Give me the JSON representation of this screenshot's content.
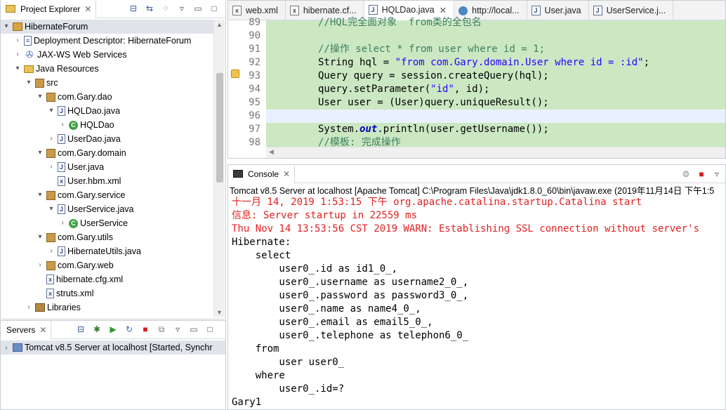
{
  "explorer": {
    "title": "Project Explorer",
    "close": "✕",
    "items": [
      {
        "label": "HibernateForum",
        "icon": "project-icon",
        "twisty": "▾"
      },
      {
        "label": "Deployment Descriptor: HibernateForum",
        "icon": "descriptor-icon",
        "twisty": "›"
      },
      {
        "label": "JAX-WS Web Services",
        "icon": "webservice-icon",
        "twisty": "›"
      },
      {
        "label": "Java Resources",
        "icon": "java-resources-icon",
        "twisty": "▾"
      },
      {
        "label": "src",
        "icon": "source-folder-icon",
        "twisty": "▾"
      },
      {
        "label": "com.Gary.dao",
        "icon": "package-icon",
        "twisty": "▾"
      },
      {
        "label": "HQLDao.java",
        "icon": "java-file-icon",
        "twisty": "▾"
      },
      {
        "label": "HQLDao",
        "icon": "class-icon",
        "twisty": "›"
      },
      {
        "label": "UserDao.java",
        "icon": "java-file-icon",
        "twisty": "›"
      },
      {
        "label": "com.Gary.domain",
        "icon": "package-icon",
        "twisty": "▾"
      },
      {
        "label": "User.java",
        "icon": "java-file-icon",
        "twisty": "›"
      },
      {
        "label": "User.hbm.xml",
        "icon": "xml-file-icon",
        "twisty": ""
      },
      {
        "label": "com.Gary.service",
        "icon": "package-icon",
        "twisty": "▾"
      },
      {
        "label": "UserService.java",
        "icon": "java-file-icon",
        "twisty": "▾"
      },
      {
        "label": "UserService",
        "icon": "class-icon",
        "twisty": "›"
      },
      {
        "label": "com.Gary.utils",
        "icon": "package-icon",
        "twisty": "▾"
      },
      {
        "label": "HibernateUtils.java",
        "icon": "java-file-icon",
        "twisty": "›"
      },
      {
        "label": "com.Gary.web",
        "icon": "package-icon",
        "twisty": "›"
      },
      {
        "label": "hibernate.cfg.xml",
        "icon": "xml-file-icon",
        "twisty": ""
      },
      {
        "label": "struts.xml",
        "icon": "xml-file-icon",
        "twisty": ""
      },
      {
        "label": "Libraries",
        "icon": "library-icon",
        "twisty": "›"
      }
    ]
  },
  "servers": {
    "title": "Servers",
    "close": "✕",
    "entry": {
      "twisty": "›",
      "label": "Tomcat v8.5 Server at localhost  [Started, Synchr"
    }
  },
  "editor": {
    "tabs": [
      {
        "label": "web.xml",
        "icon": "xml-file-icon"
      },
      {
        "label": "hibernate.cf...",
        "icon": "xml-file-icon"
      },
      {
        "label": "HQLDao.java",
        "icon": "java-file-icon",
        "active": true,
        "close": "✕"
      },
      {
        "label": "http://local...",
        "icon": "globe-icon"
      },
      {
        "label": "User.java",
        "icon": "java-file-icon"
      },
      {
        "label": "UserService.j...",
        "icon": "java-file-icon"
      }
    ],
    "line_numbers": [
      "89",
      "90",
      "91",
      "92",
      "93",
      "94",
      "95",
      "96",
      "97",
      "98"
    ],
    "code": {
      "l89": "//HQL完全面对象  from类的全包名",
      "l91": "//操作 select * from user where id = 1;",
      "l92_a": "String hql = ",
      "l92_b": "\"from com.Gary.domain.User where id = :id\"",
      "l92_c": ";",
      "l93": "Query query = session.createQuery(hql);",
      "l94_a": "query.setParameter(",
      "l94_b": "\"id\"",
      "l94_c": ", id);",
      "l95": "User user = (User)query.uniqueResult();",
      "l97_a": "System.",
      "l97_b": "out",
      "l97_c": ".println(user.getUsername());",
      "l98": "//模板: 完成操作"
    }
  },
  "console": {
    "title": "Console",
    "close": "✕",
    "description": "Tomcat v8.5 Server at localhost [Apache Tomcat] C:\\Program Files\\Java\\jdk1.8.0_60\\bin\\javaw.exe (2019年11月14日 下午1:5",
    "lines": [
      {
        "text": "十一月 14, 2019 1:53:15 下午 org.apache.catalina.startup.Catalina start",
        "err": true
      },
      {
        "text": "信息: Server startup in 22559 ms",
        "err": true
      },
      {
        "text": "Thu Nov 14 13:53:56 CST 2019 WARN: Establishing SSL connection without server's",
        "err": true
      },
      {
        "text": "Hibernate: ",
        "err": false
      },
      {
        "text": "    select",
        "err": false
      },
      {
        "text": "        user0_.id as id1_0_,",
        "err": false
      },
      {
        "text": "        user0_.username as username2_0_,",
        "err": false
      },
      {
        "text": "        user0_.password as password3_0_,",
        "err": false
      },
      {
        "text": "        user0_.name as name4_0_,",
        "err": false
      },
      {
        "text": "        user0_.email as email5_0_,",
        "err": false
      },
      {
        "text": "        user0_.telephone as telephon6_0_ ",
        "err": false
      },
      {
        "text": "    from",
        "err": false
      },
      {
        "text": "        user user0_ ",
        "err": false
      },
      {
        "text": "    where",
        "err": false
      },
      {
        "text": "        user0_.id=?",
        "err": false
      },
      {
        "text": "Gary1",
        "err": false
      }
    ]
  },
  "colors": {
    "code_bg": "#cbe8c3",
    "current_line": "#e8f2fe",
    "error_text": "#e32020",
    "selection": "#e0e4ea"
  }
}
